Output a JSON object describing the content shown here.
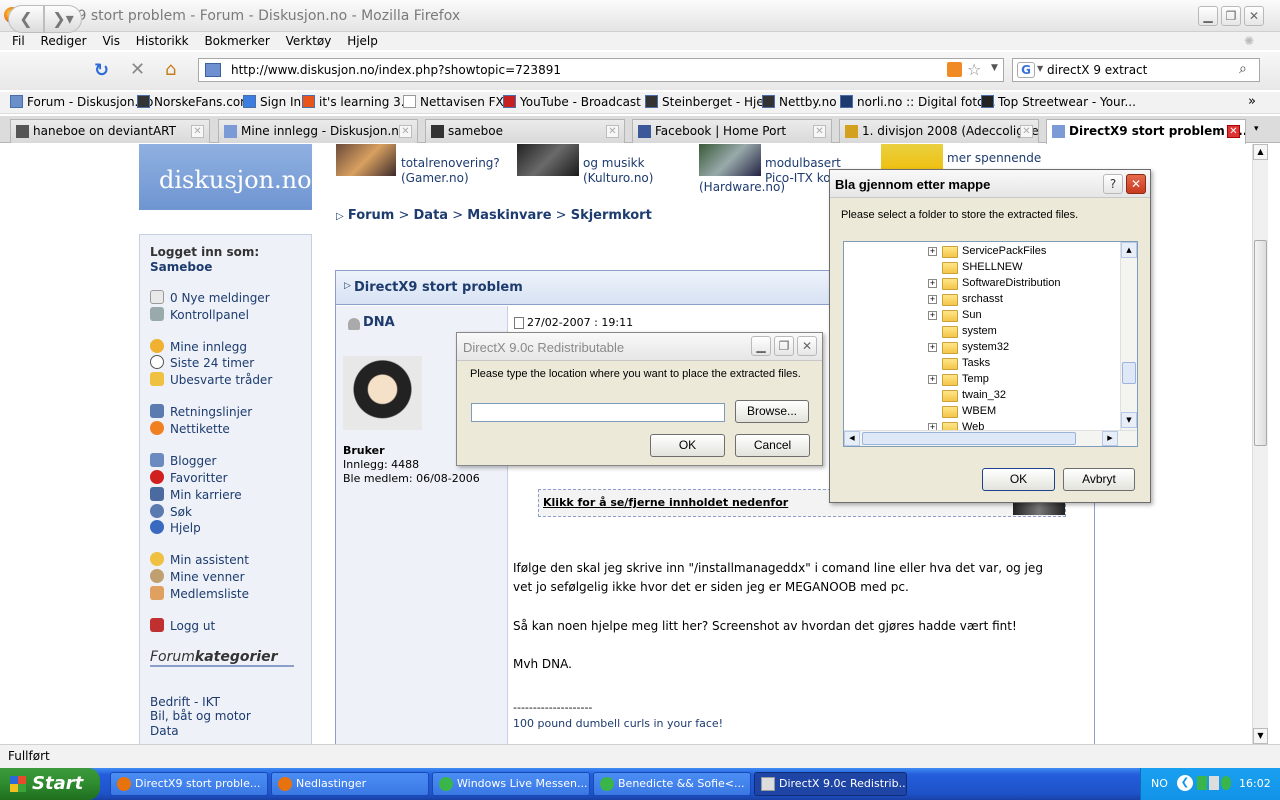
{
  "window": {
    "title": "DirectX9 stort problem - Forum - Diskusjon.no - Mozilla Firefox"
  },
  "menu": [
    "Fil",
    "Rediger",
    "Vis",
    "Historikk",
    "Bokmerker",
    "Verktøy",
    "Hjelp"
  ],
  "nav": {
    "url": "http://www.diskusjon.no/index.php?showtopic=723891",
    "search": "directX 9 extract"
  },
  "bookmarks": [
    "Forum - Diskusjon.no",
    "NorskeFans.com",
    "Sign In",
    "it's learning 3.3",
    "Nettavisen FXT",
    "YouTube - Broadcast ...",
    "Steinberget - Hjem",
    "Nettby.no",
    "norli.no :: Digital foto...",
    "Top Streetwear - Your..."
  ],
  "tabs": [
    "haneboe on deviantART",
    "Mine innlegg - Diskusjon.no",
    "sameboe",
    "Facebook | Home Port",
    "1. divisjon 2008 (Adeccoligaen...",
    "DirectX9 stort problem - ..."
  ],
  "site": {
    "logo": "diskusjon.no",
    "banner": [
      "totalrenovering?",
      "(Gamer.no)",
      "og musikk",
      "(Kulturo.no)",
      "modulbasert",
      "Pico-ITX ko",
      "(Hardware.no)",
      "mer spennende"
    ],
    "breadcrumb": [
      "Forum",
      "Data",
      "Maskinvare",
      "Skjermkort"
    ],
    "login_label": "Logget inn som:",
    "username": "Sameboe",
    "sidebar": [
      "0 Nye meldinger",
      "Kontrollpanel",
      "Mine innlegg",
      "Siste 24 timer",
      "Ubesvarte tråder",
      "Retningslinjer",
      "Nettikette",
      "Blogger",
      "Favoritter",
      "Min karriere",
      "Søk",
      "Hjelp",
      "Min assistent",
      "Mine venner",
      "Medlemsliste",
      "Logg ut"
    ],
    "categories_title_1": "Forum",
    "categories_title_2": "kategorier",
    "categories": [
      "Bedrift - IKT",
      "Bil, båt og motor",
      "Data"
    ]
  },
  "post": {
    "topic": "DirectX9 stort problem",
    "author": "DNA",
    "date": "27/02-2007 : 19:11",
    "role": "Bruker",
    "posts": "Innlegg: 4488",
    "member": "Ble medlem: 06/08-2006",
    "spoiler": "Klikk for å se/fjerne innholdet nedenfor",
    "p1": "Ifølge den skal jeg skrive inn \"/installmanageddx\" i comand line eller hva det var, og jeg",
    "p2": "vet jo sefølgelig ikke hvor det er siden jeg er MEGANOOB med pc.",
    "p3": "Så kan noen hjelpe meg litt her? Screenshot av hvordan det gjøres hadde vært fint!",
    "p4": "Mvh DNA.",
    "sig_line": "--------------------",
    "sig": "100 pound dumbell curls in your face!"
  },
  "dx_dialog": {
    "title": "DirectX 9.0c Redistributable",
    "prompt": "Please type the location where you want to place the extracted files.",
    "path_value": "",
    "browse": "Browse...",
    "ok": "OK",
    "cancel": "Cancel"
  },
  "folder_dialog": {
    "title": "Bla gjennom etter mappe",
    "prompt": "Please select a folder to store the extracted files.",
    "folders": [
      {
        "name": "ServicePackFiles",
        "expand": true
      },
      {
        "name": "SHELLNEW",
        "expand": false
      },
      {
        "name": "SoftwareDistribution",
        "expand": true
      },
      {
        "name": "srchasst",
        "expand": true
      },
      {
        "name": "Sun",
        "expand": true
      },
      {
        "name": "system",
        "expand": false
      },
      {
        "name": "system32",
        "expand": true
      },
      {
        "name": "Tasks",
        "expand": false
      },
      {
        "name": "Temp",
        "expand": true
      },
      {
        "name": "twain_32",
        "expand": false
      },
      {
        "name": "WBEM",
        "expand": false
      },
      {
        "name": "Web",
        "expand": true
      }
    ],
    "ok": "OK",
    "cancel": "Avbryt"
  },
  "status": "Fullført",
  "taskbar": {
    "start": "Start",
    "items": [
      "DirectX9 stort proble...",
      "Nedlastinger",
      "Windows Live Messen...",
      "Benedicte && Sofie<...",
      "DirectX 9.0c Redistrib..."
    ],
    "lang": "NO",
    "clock": "16:02"
  }
}
